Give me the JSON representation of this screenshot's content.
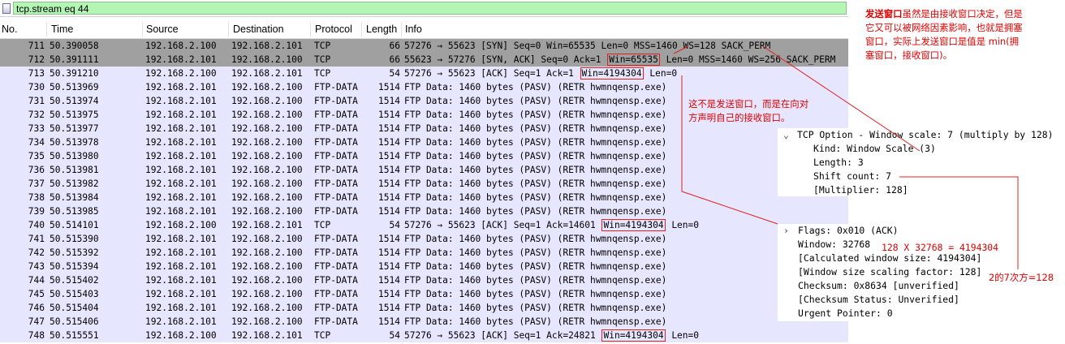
{
  "filter": {
    "value": "tcp.stream eq 44"
  },
  "columns": [
    "No.",
    "Time",
    "Source",
    "Destination",
    "Protocol",
    "Length",
    "Info"
  ],
  "packets": [
    {
      "no": "711",
      "time": "50.390058",
      "src": "192.168.2.100",
      "dst": "192.168.2.101",
      "proto": "TCP",
      "len": "66",
      "info_pre": "57276 → 55623 [SYN] Seq=0 Win=65535 Len=0 MSS=1460 WS=128 SACK_PERM",
      "win": "",
      "info_post": "",
      "style": "syn"
    },
    {
      "no": "712",
      "time": "50.391111",
      "src": "192.168.2.101",
      "dst": "192.168.2.100",
      "proto": "TCP",
      "len": "66",
      "info_pre": "55623 → 57276 [SYN, ACK] Seq=0 Ack=1 ",
      "win": "Win=65535",
      "info_post": " Len=0 MSS=1460 WS=256 SACK_PERM",
      "style": "syn"
    },
    {
      "no": "713",
      "time": "50.391210",
      "src": "192.168.2.100",
      "dst": "192.168.2.101",
      "proto": "TCP",
      "len": "54",
      "info_pre": "57276 → 55623 [ACK] Seq=1 Ack=1 ",
      "win": "Win=4194304",
      "info_post": " Len=0",
      "style": "normal"
    },
    {
      "no": "730",
      "time": "50.513969",
      "src": "192.168.2.101",
      "dst": "192.168.2.100",
      "proto": "FTP-DATA",
      "len": "1514",
      "info_pre": "FTP Data: 1460 bytes (PASV) (RETR hwmnqensp.exe)",
      "win": "",
      "info_post": "",
      "style": "normal"
    },
    {
      "no": "731",
      "time": "50.513974",
      "src": "192.168.2.101",
      "dst": "192.168.2.100",
      "proto": "FTP-DATA",
      "len": "1514",
      "info_pre": "FTP Data: 1460 bytes (PASV) (RETR hwmnqensp.exe)",
      "win": "",
      "info_post": "",
      "style": "normal"
    },
    {
      "no": "732",
      "time": "50.513975",
      "src": "192.168.2.101",
      "dst": "192.168.2.100",
      "proto": "FTP-DATA",
      "len": "1514",
      "info_pre": "FTP Data: 1460 bytes (PASV) (RETR hwmnqensp.exe)",
      "win": "",
      "info_post": "",
      "style": "normal"
    },
    {
      "no": "733",
      "time": "50.513977",
      "src": "192.168.2.101",
      "dst": "192.168.2.100",
      "proto": "FTP-DATA",
      "len": "1514",
      "info_pre": "FTP Data: 1460 bytes (PASV) (RETR hwmnqensp.exe)",
      "win": "",
      "info_post": "",
      "style": "normal"
    },
    {
      "no": "734",
      "time": "50.513978",
      "src": "192.168.2.101",
      "dst": "192.168.2.100",
      "proto": "FTP-DATA",
      "len": "1514",
      "info_pre": "FTP Data: 1460 bytes (PASV) (RETR hwmnqensp.exe)",
      "win": "",
      "info_post": "",
      "style": "normal"
    },
    {
      "no": "735",
      "time": "50.513980",
      "src": "192.168.2.101",
      "dst": "192.168.2.100",
      "proto": "FTP-DATA",
      "len": "1514",
      "info_pre": "FTP Data: 1460 bytes (PASV) (RETR hwmnqensp.exe)",
      "win": "",
      "info_post": "",
      "style": "normal"
    },
    {
      "no": "736",
      "time": "50.513981",
      "src": "192.168.2.101",
      "dst": "192.168.2.100",
      "proto": "FTP-DATA",
      "len": "1514",
      "info_pre": "FTP Data: 1460 bytes (PASV) (RETR hwmnqensp.exe)",
      "win": "",
      "info_post": "",
      "style": "normal"
    },
    {
      "no": "737",
      "time": "50.513982",
      "src": "192.168.2.101",
      "dst": "192.168.2.100",
      "proto": "FTP-DATA",
      "len": "1514",
      "info_pre": "FTP Data: 1460 bytes (PASV) (RETR hwmnqensp.exe)",
      "win": "",
      "info_post": "",
      "style": "normal"
    },
    {
      "no": "738",
      "time": "50.513984",
      "src": "192.168.2.101",
      "dst": "192.168.2.100",
      "proto": "FTP-DATA",
      "len": "1514",
      "info_pre": "FTP Data: 1460 bytes (PASV) (RETR hwmnqensp.exe)",
      "win": "",
      "info_post": "",
      "style": "normal"
    },
    {
      "no": "739",
      "time": "50.513985",
      "src": "192.168.2.101",
      "dst": "192.168.2.100",
      "proto": "FTP-DATA",
      "len": "1514",
      "info_pre": "FTP Data: 1460 bytes (PASV) (RETR hwmnqensp.exe)",
      "win": "",
      "info_post": "",
      "style": "normal"
    },
    {
      "no": "740",
      "time": "50.514101",
      "src": "192.168.2.100",
      "dst": "192.168.2.101",
      "proto": "TCP",
      "len": "54",
      "info_pre": "57276 → 55623 [ACK] Seq=1 Ack=14601 ",
      "win": "Win=4194304",
      "info_post": " Len=0",
      "style": "normal"
    },
    {
      "no": "741",
      "time": "50.515390",
      "src": "192.168.2.101",
      "dst": "192.168.2.100",
      "proto": "FTP-DATA",
      "len": "1514",
      "info_pre": "FTP Data: 1460 bytes (PASV) (RETR hwmnqensp.exe)",
      "win": "",
      "info_post": "",
      "style": "normal"
    },
    {
      "no": "742",
      "time": "50.515392",
      "src": "192.168.2.101",
      "dst": "192.168.2.100",
      "proto": "FTP-DATA",
      "len": "1514",
      "info_pre": "FTP Data: 1460 bytes (PASV) (RETR hwmnqensp.exe)",
      "win": "",
      "info_post": "",
      "style": "normal"
    },
    {
      "no": "743",
      "time": "50.515394",
      "src": "192.168.2.101",
      "dst": "192.168.2.100",
      "proto": "FTP-DATA",
      "len": "1514",
      "info_pre": "FTP Data: 1460 bytes (PASV) (RETR hwmnqensp.exe)",
      "win": "",
      "info_post": "",
      "style": "normal"
    },
    {
      "no": "744",
      "time": "50.515402",
      "src": "192.168.2.101",
      "dst": "192.168.2.100",
      "proto": "FTP-DATA",
      "len": "1514",
      "info_pre": "FTP Data: 1460 bytes (PASV) (RETR hwmnqensp.exe)",
      "win": "",
      "info_post": "",
      "style": "normal"
    },
    {
      "no": "745",
      "time": "50.515403",
      "src": "192.168.2.101",
      "dst": "192.168.2.100",
      "proto": "FTP-DATA",
      "len": "1514",
      "info_pre": "FTP Data: 1460 bytes (PASV) (RETR hwmnqensp.exe)",
      "win": "",
      "info_post": "",
      "style": "normal"
    },
    {
      "no": "746",
      "time": "50.515404",
      "src": "192.168.2.101",
      "dst": "192.168.2.100",
      "proto": "FTP-DATA",
      "len": "1514",
      "info_pre": "FTP Data: 1460 bytes (PASV) (RETR hwmnqensp.exe)",
      "win": "",
      "info_post": "",
      "style": "normal"
    },
    {
      "no": "747",
      "time": "50.515406",
      "src": "192.168.2.101",
      "dst": "192.168.2.100",
      "proto": "FTP-DATA",
      "len": "1514",
      "info_pre": "FTP Data: 1460 bytes (PASV) (RETR hwmnqensp.exe)",
      "win": "",
      "info_post": "",
      "style": "normal"
    },
    {
      "no": "748",
      "time": "50.515551",
      "src": "192.168.2.100",
      "dst": "192.168.2.101",
      "proto": "TCP",
      "len": "54",
      "info_pre": "57276 → 55623 [ACK] Seq=1 Ack=24821 ",
      "win": "Win=4194304",
      "info_post": " Len=0",
      "style": "normal"
    }
  ],
  "option_panel": {
    "lines": [
      "TCP Option - Window scale: 7 (multiply by 128)",
      "Kind: Window Scale (3)",
      "Length: 3",
      "Shift count: 7",
      "[Multiplier: 128]"
    ]
  },
  "flags_panel": {
    "lines": [
      "Flags: 0x010 (ACK)",
      "Window: 32768",
      "[Calculated window size: 4194304]",
      "[Window size scaling factor: 128]",
      "Checksum: 0x8634 [unverified]",
      "[Checksum Status: Unverified]",
      "Urgent Pointer: 0"
    ]
  },
  "annotations": {
    "top_right_bold": "发送窗口",
    "top_right_rest1": "虽然是由接收窗口决定，但是",
    "top_right_line2": "它又可以被网络因素影响，也就是拥塞",
    "top_right_line3": "窗口，实际上发送窗口是值是 min(拥",
    "top_right_line4": "塞窗口，接收窗口)。",
    "middle_line1": "这不是发送窗口，而是在向对",
    "middle_line2": "方声明自己的接收窗口。",
    "calc": "128 X 32768 = 4194304",
    "power": "2的7次方=128"
  },
  "colors": {
    "syn_row": "#a0a0a0",
    "normal_row": "#e7e6ff",
    "filter_bg": "#b3f5b3",
    "annotation": "#e00000"
  }
}
